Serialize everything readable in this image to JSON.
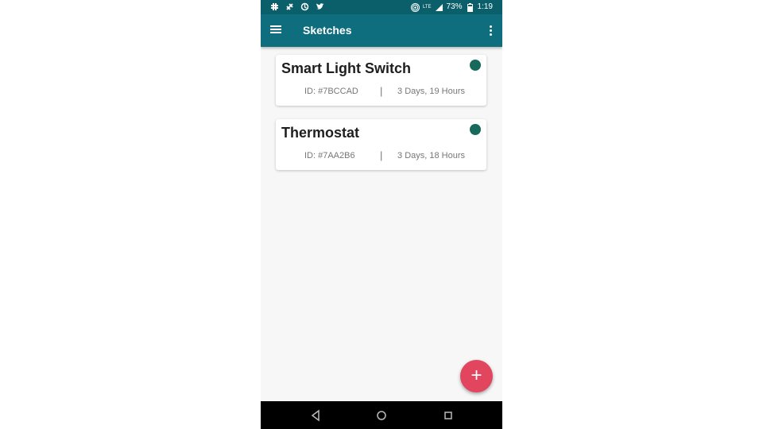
{
  "status_bar": {
    "icons_left": [
      "slack-icon",
      "slack-alt-icon",
      "sync-icon",
      "twitter-icon"
    ],
    "battery": "73%",
    "time": "1:19",
    "network": "LTE"
  },
  "app_bar": {
    "title": "Sketches",
    "menu_icon": "hamburger-icon",
    "overflow_icon": "more-vert-icon",
    "color": "#0f6e7e"
  },
  "sketches": [
    {
      "title": "Smart Light Switch",
      "id": "ID: #7BCCAD",
      "separator": "|",
      "age": "3 Days, 19 Hours",
      "status_color": "#17695c"
    },
    {
      "title": "Thermostat",
      "id": "ID: #7AA2B6",
      "separator": "|",
      "age": "3 Days, 18 Hours",
      "status_color": "#17695c"
    }
  ],
  "fab": {
    "label": "+",
    "color": "#e2465f"
  },
  "nav_bar": {
    "icons": [
      "back-icon",
      "home-icon",
      "recents-icon"
    ]
  }
}
